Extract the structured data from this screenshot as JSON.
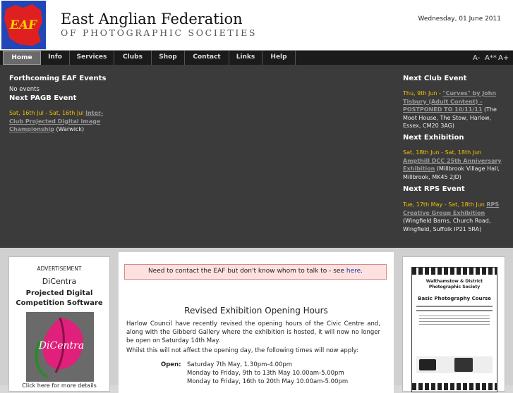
{
  "header": {
    "logo_text": "EAF",
    "title": "East Anglian Federation",
    "subtitle": "OF PHOTOGRAPHIC SOCIETIES",
    "date": "Wednesday, 01 June 2011"
  },
  "nav": {
    "items": [
      {
        "label": "Home",
        "active": true
      },
      {
        "label": "Info"
      },
      {
        "label": "Services"
      },
      {
        "label": "Clubs"
      },
      {
        "label": "Shop"
      },
      {
        "label": "Contact"
      },
      {
        "label": "Links"
      },
      {
        "label": "Help"
      }
    ],
    "font_controls": [
      "A-",
      "A**",
      "A+"
    ]
  },
  "events": {
    "eaf": {
      "heading": "Forthcoming EAF Events",
      "text": "No events"
    },
    "pagb": {
      "heading": "Next PAGB Event",
      "date": "Sat, 16th Jul - Sat, 16th Jul",
      "link": "Inter-Club Projected Digital Image Championship",
      "location": "(Warwick)"
    },
    "club": {
      "heading": "Next Club Event",
      "date": "Thu, 9th Jun -",
      "link": "\"Curves\" by John Tisbury (Adult Content) - POSTPONED TO 10/11/11",
      "location": "(The Moot House, The Stow, Harlow, Essex, CM20 3AG)"
    },
    "exhibition": {
      "heading": "Next Exhibition",
      "date": "Sat, 18th Jun - Sat, 18th Jun",
      "link": "Ampthill DCC 25th Anniversary Exhibition",
      "location": "(Millbrook Village Hall, Millbrook, MK45 2JD)"
    },
    "rps": {
      "heading": "Next RPS Event",
      "date": "Tue, 17th May - Sat, 18th Jun",
      "link": "RPS Creative Group Exhibition",
      "location": "(Wingfield Barns, Church Road, Wingfield, Suffolk IP21 5RA)"
    }
  },
  "advert": {
    "label": "ADVERTISEMENT",
    "brand": "DiCentra",
    "product": "Projected Digital Competition Software",
    "image_text": "DiCentra",
    "footer": "Click here for more details"
  },
  "main": {
    "contact_text": "Need to contact the EAF but don't know whom to talk to - see",
    "contact_link": "here",
    "contact_end": ".",
    "title": "Revised Exhibition Opening Hours",
    "para1": "Harlow Council have recently revised the opening hours of the Civic Centre and, along with the Gibberd Gallery where the exhibition is hosted, it will now no longer be open on Saturday 14th May.",
    "para2": "Whilst this will not affect the opening day, the following times will now apply:",
    "open_label": "Open:",
    "rows": [
      "Saturday 7th May, 1.30pm-4.00pm",
      "Monday to Friday, 9th to 13th May 10.00am-5.00pm",
      "Monday to Friday, 16th to 20th May 10.00am-5.00pm"
    ]
  },
  "poster": {
    "club": "Walthamstow & District Photographic Society",
    "course": "Basic Photography Course"
  }
}
